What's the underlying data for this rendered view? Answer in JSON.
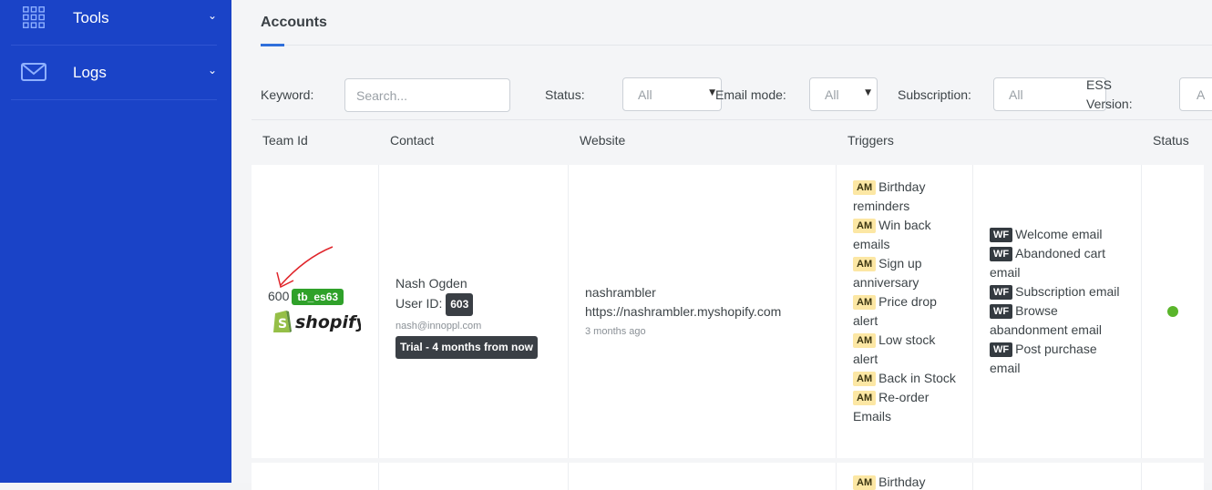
{
  "sidebar": {
    "items": [
      {
        "label": "Tools",
        "icon": "grid-icon"
      },
      {
        "label": "Logs",
        "icon": "mail-icon"
      }
    ]
  },
  "page": {
    "title": "Accounts"
  },
  "filters": {
    "keyword_label": "Keyword:",
    "keyword_placeholder": "Search...",
    "status_label": "Status:",
    "status_value": "All",
    "email_mode_label": "Email mode:",
    "email_mode_value": "All",
    "subscription_label": "Subscription:",
    "subscription_value": "All",
    "ess_label_1": "ESS",
    "ess_label_2": "Version:",
    "ess_value": "A"
  },
  "table": {
    "headers": [
      "Team Id",
      "Contact",
      "Website",
      "Triggers",
      "Status"
    ],
    "rows": [
      {
        "team_id": "600",
        "team_tag": "tb_es63",
        "platform": "shopify",
        "contact_name": "Nash Ogden",
        "user_id_label": "User ID:",
        "user_id": "603",
        "email": "nash@innoppl.com",
        "plan": "Trial - 4 months from now",
        "website_name": "nashrambler",
        "website_url": "https://nashrambler.myshopify.com",
        "website_time": "3 months ago",
        "am_tag": "AM",
        "wf_tag": "WF",
        "am_triggers": [
          "Birthday reminders",
          "Win back emails",
          "Sign up anniversary",
          "Price drop alert",
          "Low stock alert",
          "Back in Stock",
          "Re-order Emails"
        ],
        "wf_triggers": [
          "Welcome email",
          "Abandoned cart email",
          "Subscription email",
          "Browse abandonment email",
          "Post purchase email"
        ],
        "status_color": "#5ab52b"
      }
    ],
    "next_row_partial_trigger": "Birthday"
  },
  "colors": {
    "sidebar": "#1a43c7",
    "accent": "#2f6fdb",
    "green_badge": "#2fa12a",
    "am_badge": "#fce7a4"
  }
}
